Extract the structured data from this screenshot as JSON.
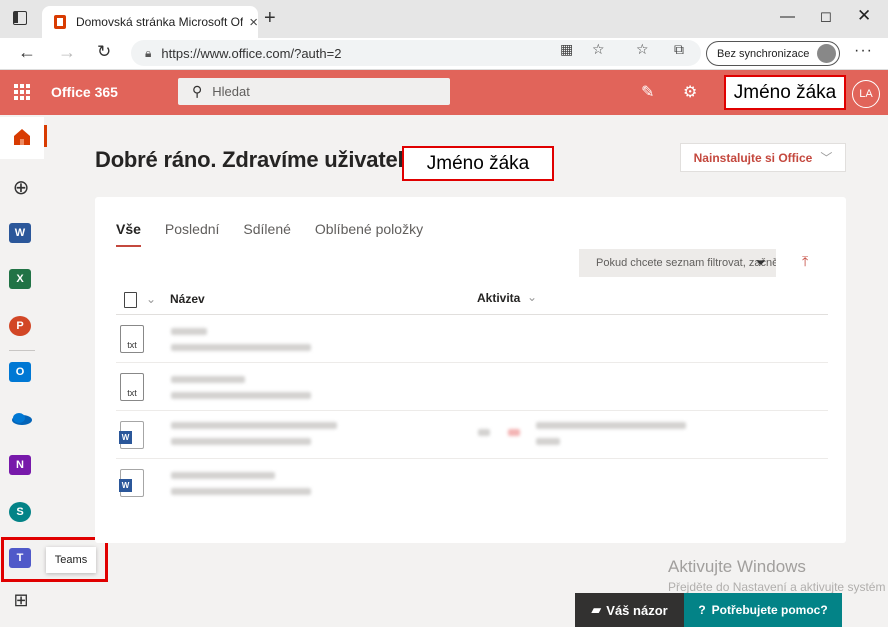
{
  "browser": {
    "tab_title": "Domovská stránka Microsoft Office",
    "url": "https://www.office.com/?auth=2",
    "sync_label": "Bez synchronizace"
  },
  "header": {
    "brand": "Office 365",
    "search_placeholder": "Hledat",
    "student_name": "Jméno žáka",
    "avatar_initials": "LA",
    "accent_color": "#e1645a"
  },
  "rail": {
    "teams_tooltip": "Teams"
  },
  "main": {
    "greeting": "Dobré ráno. Zdravíme uživatele",
    "student_name": "Jméno žáka",
    "install_button": "Nainstalujte si Office",
    "tabs": [
      {
        "label": "Vše"
      },
      {
        "label": "Poslední"
      },
      {
        "label": "Sdílené"
      },
      {
        "label": "Oblíbené položky"
      }
    ],
    "filter_placeholder": "Pokud chcete seznam filtrovat, začně",
    "columns": {
      "name": "Název",
      "activity": "Aktivita"
    }
  },
  "footer": {
    "watermark_title": "Aktivujte Windows",
    "watermark_sub": "Přejděte do Nastavení a aktivujte systém Windows.",
    "feedback": "Váš názor",
    "help": "Potřebujete pomoc?"
  }
}
